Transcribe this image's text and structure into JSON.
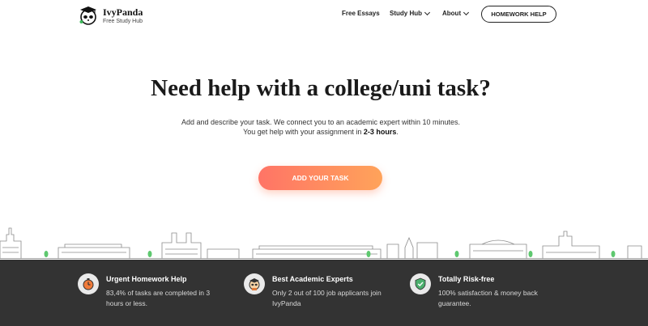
{
  "header": {
    "logo_name": "IvyPanda",
    "logo_sub": "Free Study Hub",
    "nav": {
      "essays": "Free Essays",
      "hub": "Study Hub",
      "about": "About"
    },
    "homework_button": "HOMEWORK HELP"
  },
  "hero": {
    "title": "Need help with a college/uni task?",
    "line1": "Add and describe your task. We connect you to an academic expert within 10 minutes.",
    "line2_prefix": "You get help with your assignment in ",
    "line2_bold": "2-3 hours",
    "line2_suffix": ".",
    "cta": "ADD YOUR TASK"
  },
  "features": [
    {
      "title": "Urgent Homework Help",
      "desc": "83,4% of tasks are completed in 3 hours or less.",
      "icon": "timer-icon"
    },
    {
      "title": "Best Academic Experts",
      "desc": "Only 2 out of 100 job applicants join IvyPanda",
      "icon": "expert-panda-icon"
    },
    {
      "title": "Totally Risk-free",
      "desc": "100% satisfaction & money back guarantee.",
      "icon": "shield-icon"
    }
  ],
  "colors": {
    "cta_gradient_start": "#ff7466",
    "cta_gradient_end": "#ffa35a",
    "footer_band": "#333333"
  }
}
